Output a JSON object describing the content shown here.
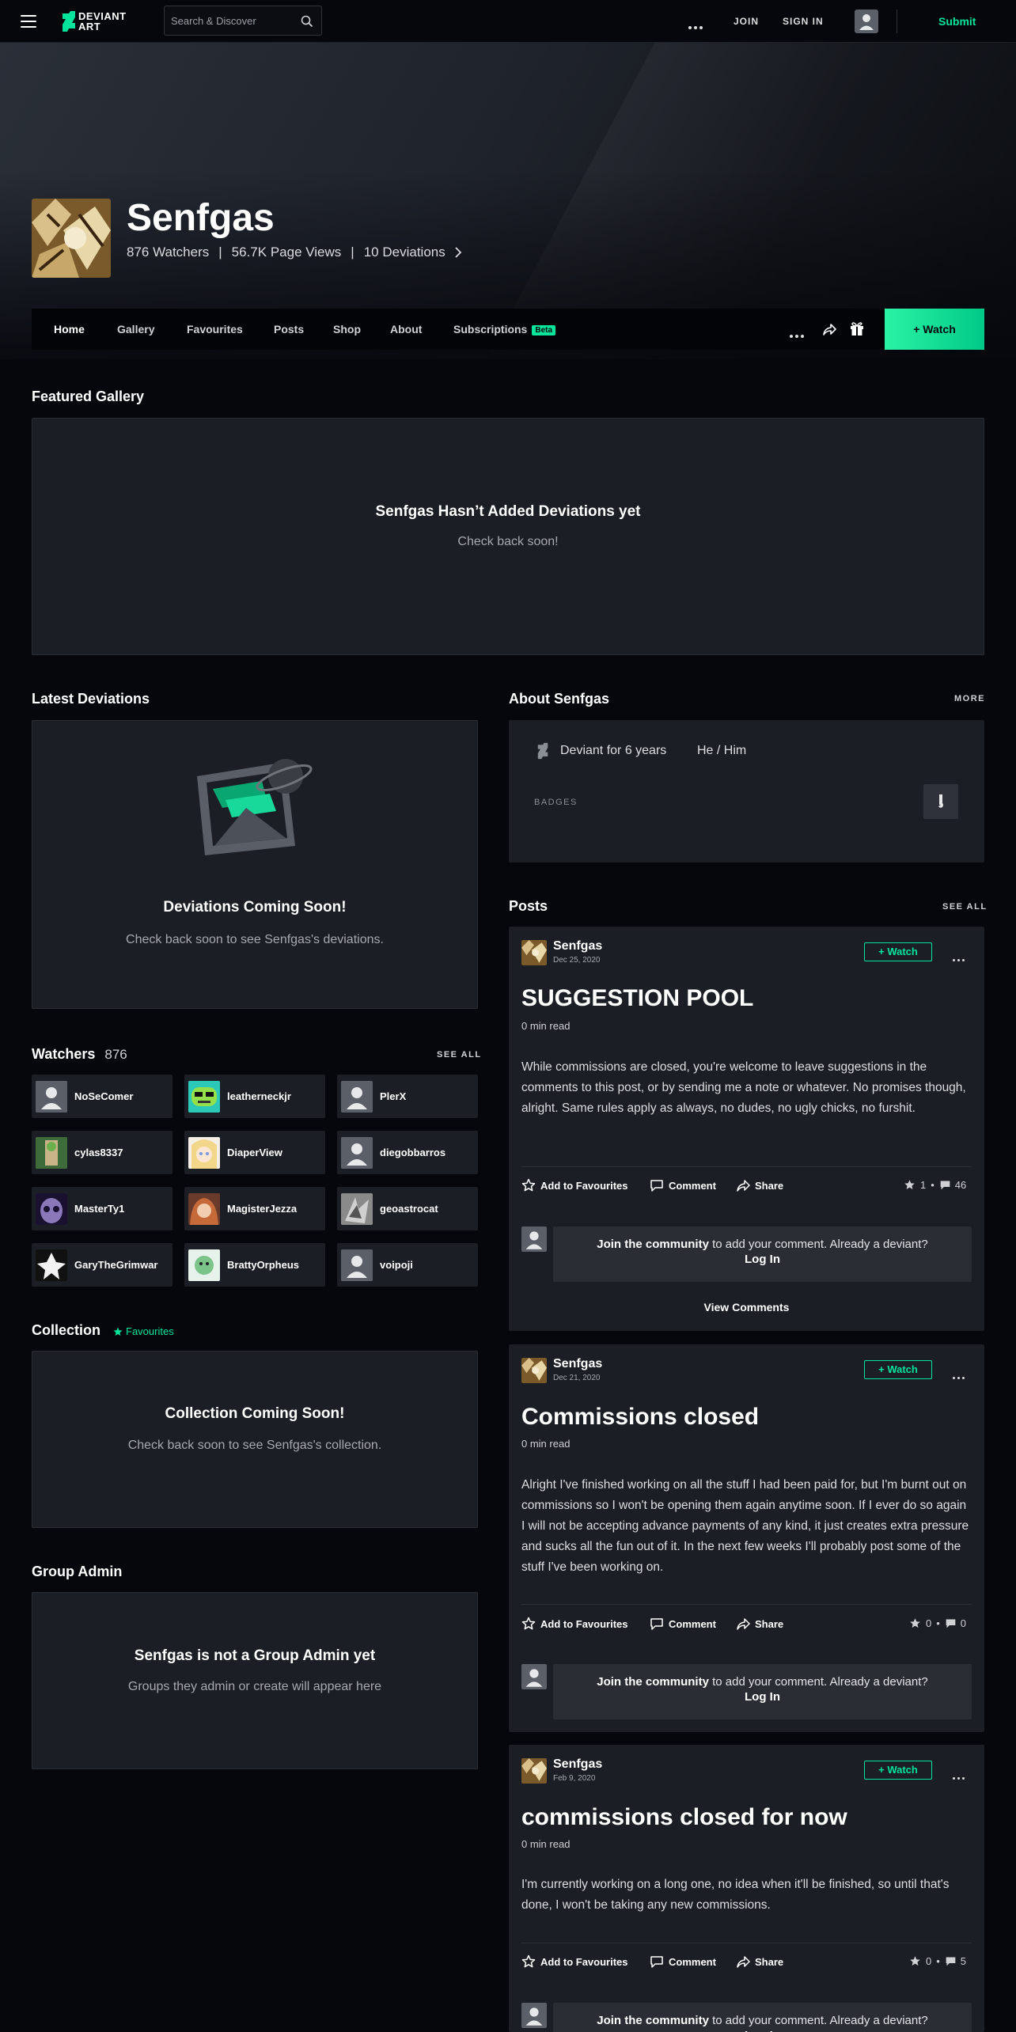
{
  "topbar": {
    "logo_line1": "DEVIANT",
    "logo_line2": "ART",
    "search_placeholder": "Search & Discover",
    "join": "JOIN",
    "sign_in": "SIGN IN",
    "submit": "Submit"
  },
  "profile": {
    "name": "Senfgas",
    "watchers": "876 Watchers",
    "page_views": "56.7K Page Views",
    "deviations": "10 Deviations",
    "sep": "|"
  },
  "nav": {
    "items": [
      "Home",
      "Gallery",
      "Favourites",
      "Posts",
      "Shop",
      "About",
      "Subscriptions"
    ],
    "beta": "Beta",
    "watch": "+ Watch"
  },
  "featured": {
    "heading": "Featured Gallery",
    "empty_title": "Senfgas Hasn’t Added Deviations yet",
    "empty_sub": "Check back soon!"
  },
  "latest": {
    "heading": "Latest Deviations",
    "empty_title": "Deviations Coming Soon!",
    "empty_sub": "Check back soon to see Senfgas's deviations."
  },
  "watchers": {
    "heading": "Watchers",
    "count": "876",
    "see_all": "SEE ALL",
    "list": [
      "NoSeComer",
      "leatherneckjr",
      "PlerX",
      "cylas8337",
      "DiaperView",
      "diegobbarros",
      "MasterTy1",
      "MagisterJezza",
      "geoastrocat",
      "GaryTheGrimwar",
      "BrattyOrpheus",
      "voipoji"
    ]
  },
  "collection": {
    "heading": "Collection",
    "tag": "Favourites",
    "empty_title": "Collection Coming Soon!",
    "empty_sub": "Check back soon to see Senfgas's collection."
  },
  "group_admin": {
    "heading": "Group Admin",
    "empty_title": "Senfgas is not a Group Admin yet",
    "empty_sub": "Groups they admin or create will appear here"
  },
  "about": {
    "heading": "About Senfgas",
    "more": "MORE",
    "deviant_for": "Deviant for 6 years",
    "pronouns": "He / Him",
    "badges": "BADGES"
  },
  "posts": {
    "heading": "Posts",
    "see_all": "SEE ALL",
    "watch": "+ Watch",
    "add_fav": "Add to Favourites",
    "comment": "Comment",
    "share": "Share",
    "join_bold": "Join the community",
    "join_rest": " to add your comment. Already a deviant?",
    "log_in": "Log In",
    "view_comments": "View Comments",
    "read": "0 min read",
    "items": [
      {
        "author": "Senfgas",
        "date": "Dec 25, 2020",
        "title": "SUGGESTION POOL",
        "body": "While commissions are closed, you're welcome to leave suggestions in the comments to this post, or by sending me a note or whatever. No promises though, alright. Same rules apply as always, no dudes, no ugly chicks, no furshit.",
        "favs": "1",
        "comments": "46"
      },
      {
        "author": "Senfgas",
        "date": "Dec 21, 2020",
        "title": "Commissions closed",
        "body": "Alright I've finished working on all the stuff I had been paid for, but I'm burnt out on commissions so I won't be opening them again anytime soon. If I ever do so again I will not be accepting advance payments of any kind, it just creates extra pressure and sucks all the fun out of it. In the next few weeks I'll probably post some of the stuff I've been working on.",
        "favs": "0",
        "comments": "0"
      },
      {
        "author": "Senfgas",
        "date": "Feb 9, 2020",
        "title": "commissions closed for now",
        "body": "I'm currently working on a long one, no idea when it'll be finished, so until that's done, I won't be taking any new commissions.",
        "favs": "0",
        "comments": "5"
      }
    ]
  },
  "colors": {
    "accent": "#00e59b",
    "panel": "#1b1e24",
    "bg": "#06070d"
  }
}
